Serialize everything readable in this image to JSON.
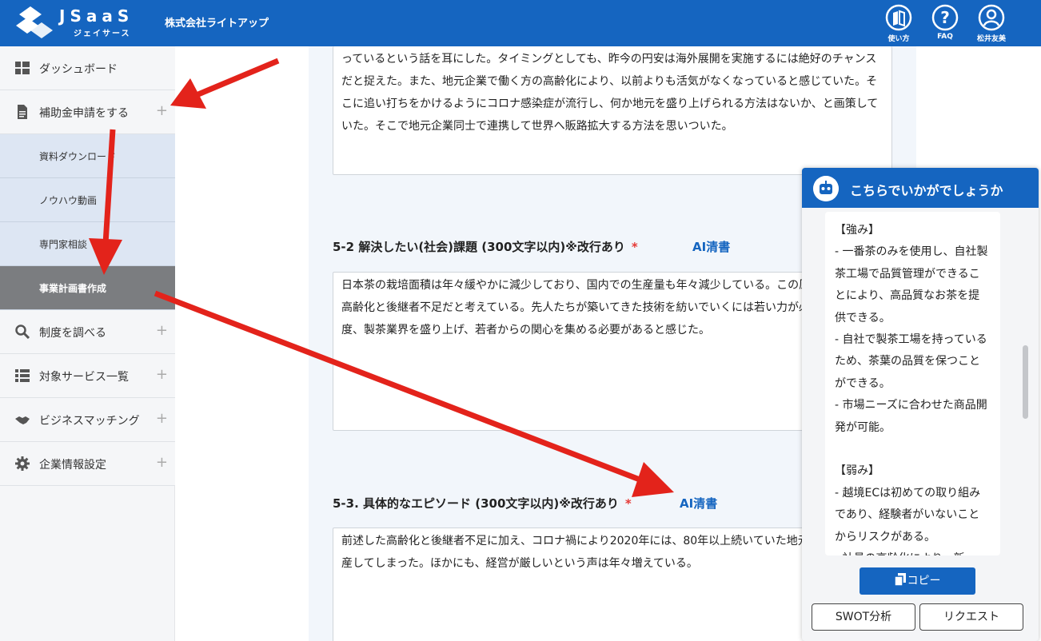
{
  "header": {
    "logo_text": "JSaaS",
    "logo_sub": "ジェイサース",
    "company": "株式会社ライトアップ",
    "buttons": [
      {
        "label": "使い方",
        "icon": "manual-icon"
      },
      {
        "label": "FAQ",
        "icon": "question-icon"
      },
      {
        "label": "松井友美",
        "icon": "user-icon"
      }
    ]
  },
  "sidebar": {
    "items": [
      {
        "label": "ダッシュボード",
        "icon": "dashboard-icon"
      },
      {
        "label": "補助金申請をする",
        "icon": "document-icon",
        "plus": "+"
      },
      {
        "label": "制度を調べる",
        "icon": "search-icon",
        "plus": "+"
      },
      {
        "label": "対象サービス一覧",
        "icon": "list-icon",
        "plus": "+"
      },
      {
        "label": "ビジネスマッチング",
        "icon": "handshake-icon",
        "plus": "+"
      },
      {
        "label": "企業情報設定",
        "icon": "gear-icon",
        "plus": "+"
      }
    ],
    "sub_items": [
      {
        "label": "資料ダウンロード"
      },
      {
        "label": "ノウハウ動画"
      },
      {
        "label": "専門家相談"
      },
      {
        "label": "事業計画書作成",
        "active": true
      }
    ]
  },
  "main": {
    "box1_text": "っているという話を耳にした。タイミングとしても、昨今の円安は海外展開を実施するには絶好のチャンスだと捉えた。また、地元企業で働く方の高齢化により、以前よりも活気がなくなっていると感じていた。そこに追い打ちをかけるようにコロナ感染症が流行し、何か地元を盛り上げられる方法はないか、と画策していた。そこで地元企業同士で連携して世界へ販路拡大する方法を思いついた。",
    "section2": {
      "title": "5-2 解決したい(社会)課題 (300文字以内)※改行あり",
      "required": "*",
      "ai_link": "AI清書",
      "text": "日本茶の栽培面積は年々緩やかに減少しており、国内での生産量も年々減少している。この原因は生産者の高齢化と後継者不足だと考えている。先人たちが築いてきた技術を紡いでいくには若い力が必須である。再度、製茶業界を盛り上げ、若者からの関心を集める必要があると感じた。"
    },
    "section3": {
      "title": "5-3. 具体的なエピソード (300文字以内)※改行あり",
      "required": "*",
      "ai_link": "AI清書",
      "text": "前述した高齢化と後継者不足に加え、コロナ禍により2020年には、80年以上続いていた地元の茶農家が倒産してしまった。ほかにも、経営が厳しいという声は年々増えている。"
    }
  },
  "chat": {
    "title": "こちらでいかがでしょうか",
    "body": "【強み】\n- 一番茶のみを使用し、自社製茶工場で品質管理ができることにより、高品質なお茶を提供できる。\n- 自社で製茶工場を持っているため、茶葉の品質を保つことができる。\n- 市場ニーズに合わせた商品開発が可能。\n\n【弱み】\n- 越境ECは初めての取り組みであり、経験者がいないことからリスクがある。\n- 社員の高齢化により、新",
    "copy_label": "コピー",
    "swot_label": "SWOT分析",
    "request_label": "リクエスト"
  },
  "colors": {
    "primary": "#1565c0",
    "arrow": "#e3231b",
    "active_sidebar": "#7b7d80"
  }
}
